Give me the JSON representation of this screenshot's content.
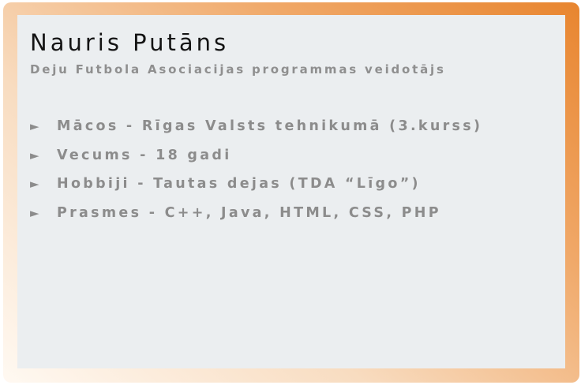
{
  "profile": {
    "name": "Nauris Putāns",
    "subtitle": "Deju Futbola Asociacijas programmas veidotājs"
  },
  "bullet_glyph": "►",
  "facts": [
    {
      "text": "Mācos - Rīgas Valsts tehnikumā (3.kurss)"
    },
    {
      "text": "Vecums - 18 gadi"
    },
    {
      "text": "Hobbiji - Tautas dejas (TDA “Līgo”)"
    },
    {
      "text": "Prasmes - C++, Java, HTML, CSS, PHP"
    }
  ],
  "colors": {
    "gradient_start": "#fff9f2",
    "gradient_end": "#e8852f",
    "panel_background": "#ebeef0",
    "name_text": "#141414",
    "secondary_text": "#8c8c8c"
  }
}
